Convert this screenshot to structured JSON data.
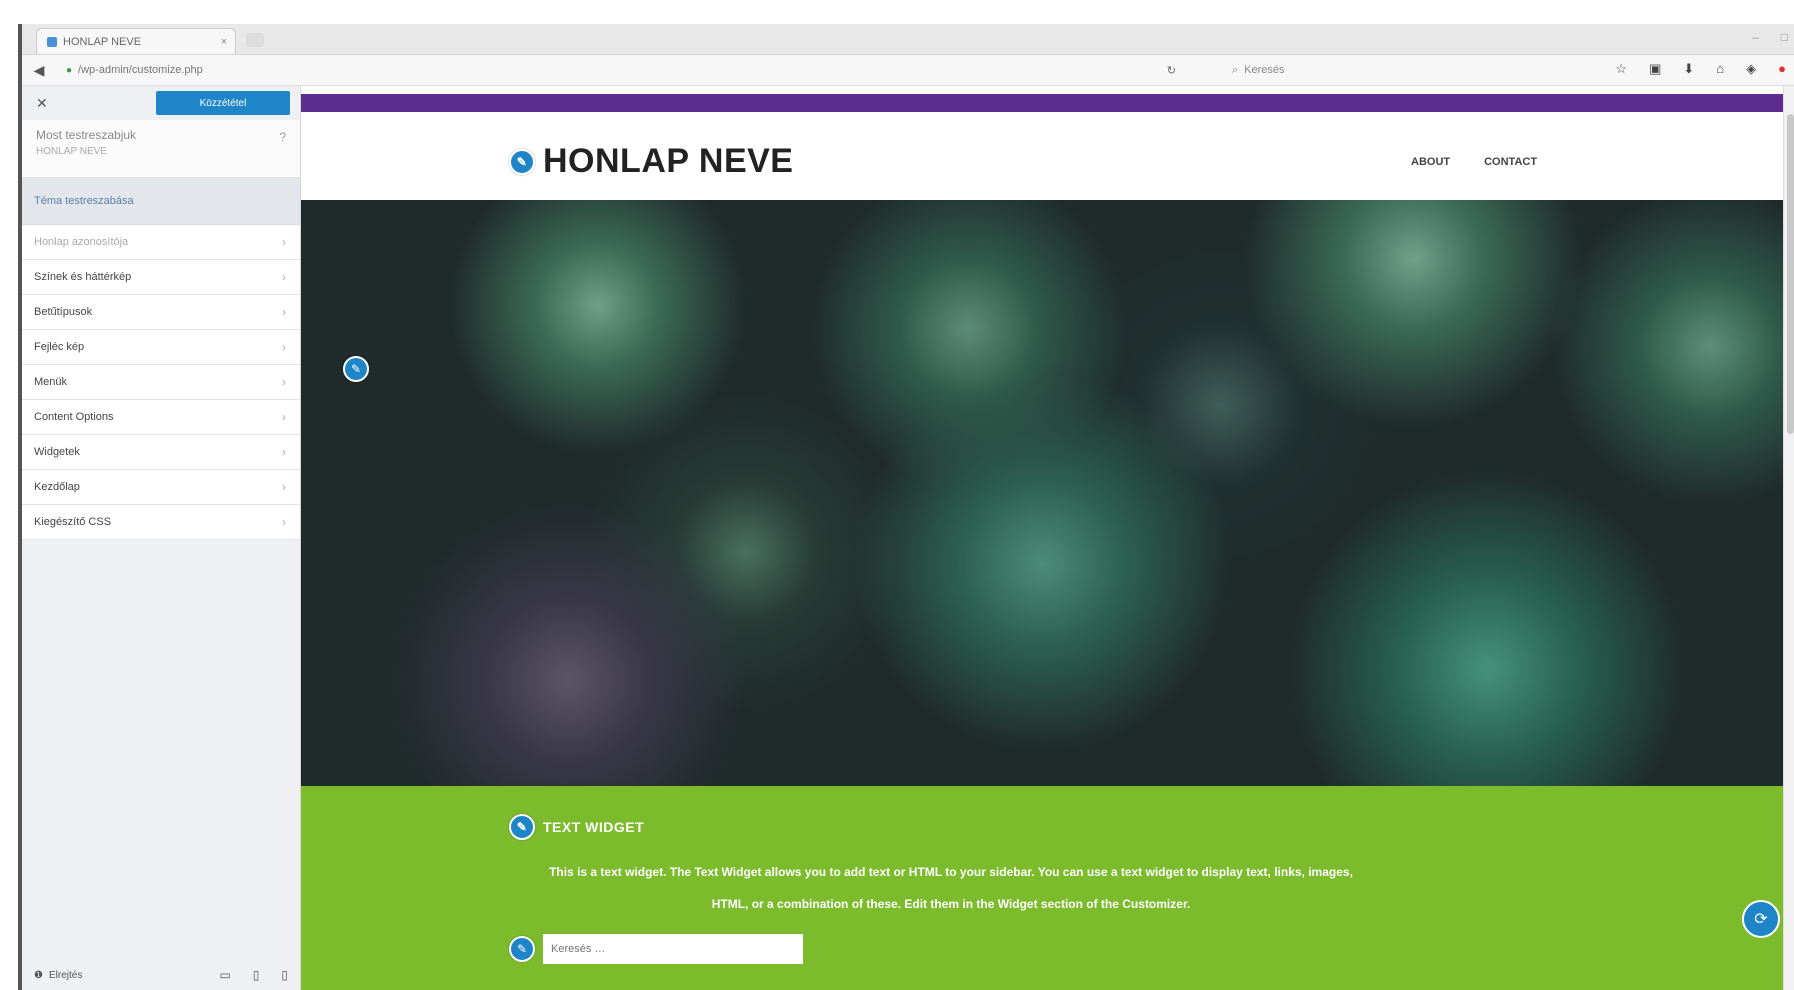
{
  "browser": {
    "tab_title": "HONLAP NEVE",
    "url": "/wp-admin/customize.php",
    "search_placeholder": "Keresés"
  },
  "sidebar": {
    "publish_label": "Közzététel",
    "info_title": "Most testreszabjuk",
    "info_subtitle": "HONLAP NEVE",
    "active_item": "Téma testreszabása",
    "items": [
      {
        "label": "Honlap azonosítója"
      },
      {
        "label": "Színek és háttérkép"
      },
      {
        "label": "Betűtípusok"
      },
      {
        "label": "Fejléc kép"
      },
      {
        "label": "Menük"
      },
      {
        "label": "Content Options"
      },
      {
        "label": "Widgetek"
      },
      {
        "label": "Kezdőlap"
      },
      {
        "label": "Kiegészítő CSS"
      }
    ],
    "bottom_label": "Elrejtés"
  },
  "site": {
    "title": "HONLAP NEVE",
    "menu": [
      "ABOUT",
      "CONTACT"
    ],
    "widget_title": "TEXT WIDGET",
    "widget_text": "This is a text widget. The Text Widget allows you to add text or HTML to your sidebar. You can use a text widget to display text, links, images, HTML, or a combination of these. Edit them in the Widget section of the Customizer.",
    "search_placeholder": "Keresés …"
  },
  "colors": {
    "purple_bar": "#5b2d8e",
    "green_band": "#7cbc2c",
    "accent": "#1e86c8"
  }
}
